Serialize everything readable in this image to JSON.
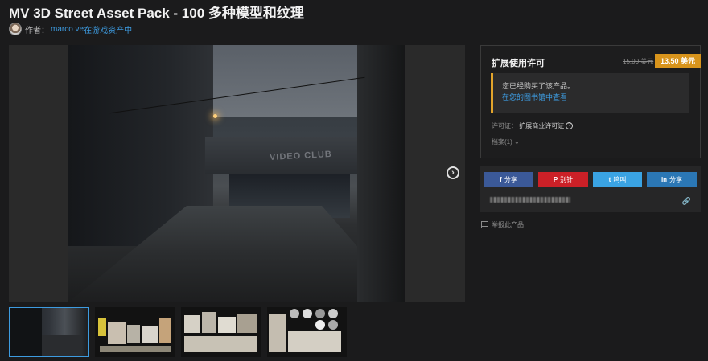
{
  "product": {
    "title": "MV 3D Street Asset Pack - 100 多种模型和纹理",
    "author_prefix": "作者：",
    "author_name": "marco ve",
    "author_suffix": "在游戏资产中"
  },
  "gallery": {
    "hero_sign_text": "VIDEO CLUB",
    "next_icon": "chevron-right-circle-icon",
    "thumbnails": [
      "thumbnail-1",
      "thumbnail-2",
      "thumbnail-3",
      "thumbnail-4"
    ],
    "active_thumbnail": 0
  },
  "license_panel": {
    "title": "扩展使用许可",
    "original_price": "15.00 美元",
    "sale_price": "13.50 美元",
    "notice_text": "您已经购买了该产品。",
    "notice_link": "在您的图书馆中查看",
    "license_label": "许可证：",
    "license_value": "扩展商业许可证",
    "files_label": "档案(1)",
    "files_chevron": "⌄"
  },
  "share": {
    "facebook_label": "分享",
    "pinterest_label": "别针",
    "twitter_label": "鸣叫",
    "linkedin_label": "分享",
    "link_icon": "link-icon"
  },
  "report": {
    "label": "举报此产品"
  },
  "colors": {
    "accent_blue": "#3d9be0",
    "price_orange": "#d8941c",
    "notice_border": "#e2a42b",
    "facebook": "#3b5998",
    "pinterest": "#cb2027",
    "twitter": "#3aa3e3",
    "linkedin": "#2b77b5"
  }
}
